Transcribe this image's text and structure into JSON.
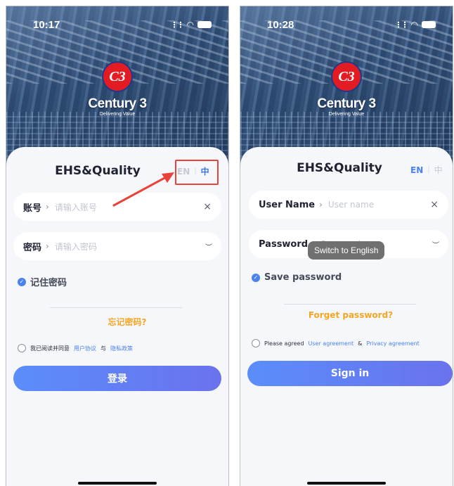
{
  "left": {
    "status_time": "10:17",
    "brand_name": "Century 3",
    "brand_tagline": "Delivering Value",
    "app_title": "EHS&Quality",
    "lang_en": "EN",
    "lang_sep": "|",
    "lang_zh": "中",
    "account_label": "账号",
    "account_placeholder": "请输入账号",
    "clear_icon_glyph": "×",
    "password_label": "密码",
    "password_placeholder": "请输入密码",
    "eye_icon_glyph": "︶",
    "remember_label": "记住密码",
    "forgot_label": "忘记密码?",
    "agree_prefix": "我已阅读并同意",
    "agree_link1": "用户协议",
    "agree_and": "与",
    "agree_link2": "隐私政策",
    "login_button": "登录"
  },
  "right": {
    "status_time": "10:28",
    "brand_name": "Century 3",
    "brand_tagline": "Delivering Value",
    "app_title": "EHS&Quality",
    "lang_en": "EN",
    "lang_sep": "|",
    "lang_zh": "中",
    "user_label": "User Name",
    "user_placeholder": "User name",
    "clear_icon_glyph": "×",
    "password_label": "Password",
    "password_placeholder": "Password",
    "eye_icon_glyph": "︶",
    "tooltip": "Switch to English",
    "remember_label": "Save password",
    "forgot_label": "Forget password?",
    "agree_prefix": "Please agreed",
    "agree_link1": "User agreement",
    "agree_and": "&",
    "agree_link2": "Privacy agreement",
    "login_button": "Sign in"
  },
  "colors": {
    "accent_blue": "#4a82f0",
    "forgot_orange": "#f5a623",
    "highlight_red": "#e8423a",
    "logo_red": "#e31b23"
  },
  "icons": [
    "signal-icon",
    "wifi-icon",
    "battery-icon",
    "chevron-right-icon",
    "clear-icon",
    "eye-closed-icon",
    "check-circle-icon",
    "radio-icon",
    "arrow-annotation"
  ]
}
